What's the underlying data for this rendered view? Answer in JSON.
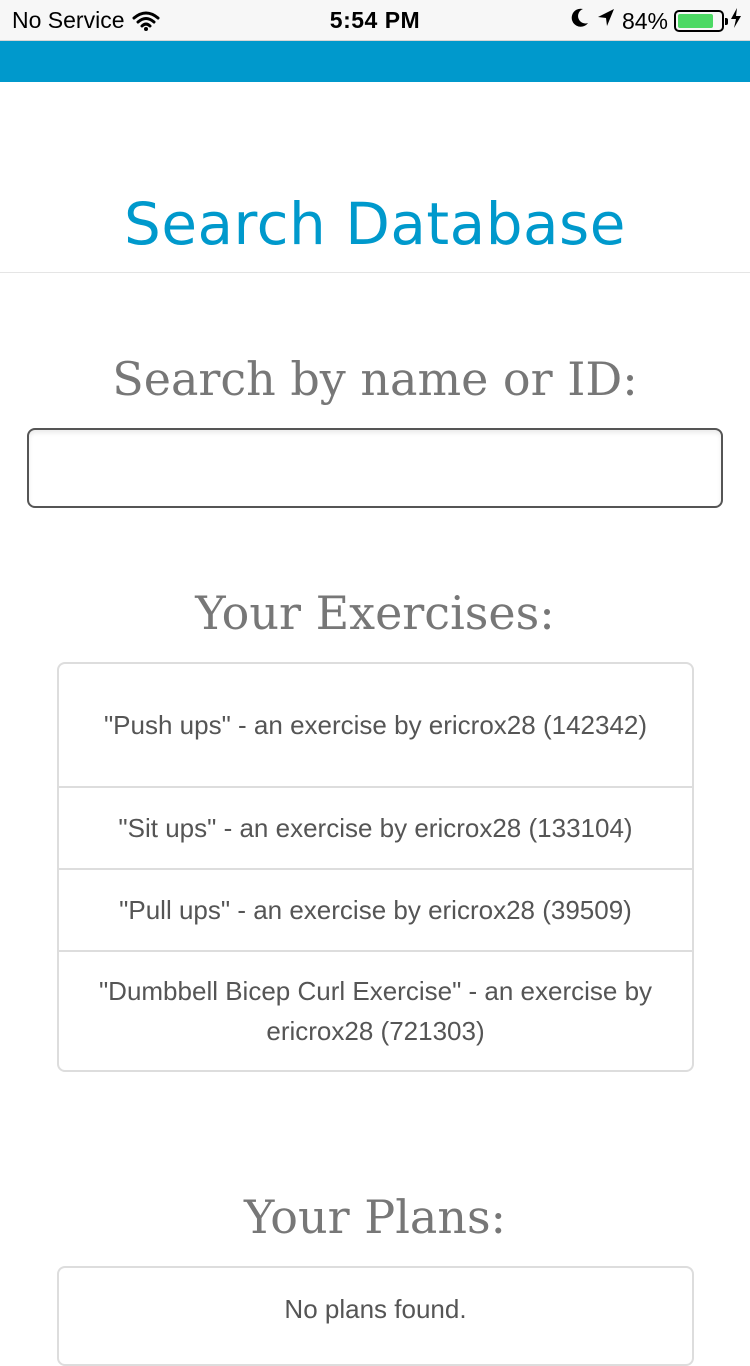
{
  "status_bar": {
    "carrier": "No Service",
    "time": "5:54 PM",
    "battery_percent": "84%",
    "battery_level": 0.84,
    "battery_color": "#4cd964",
    "icons": [
      "wifi-icon",
      "moon-icon",
      "location-icon",
      "battery-icon",
      "bolt-icon"
    ]
  },
  "nav": {
    "color": "#0099cc"
  },
  "header": {
    "title": "Search Database"
  },
  "search": {
    "label": "Search by name or ID:",
    "value": "",
    "placeholder": ""
  },
  "exercises": {
    "heading": "Your Exercises:",
    "items": [
      {
        "label": "\"Push ups\" - an exercise by ericrox28 (142342)"
      },
      {
        "label": "\"Sit ups\" - an exercise by ericrox28 (133104)"
      },
      {
        "label": "\"Pull ups\" - an exercise by ericrox28 (39509)"
      },
      {
        "label": "\"Dumbbell Bicep Curl Exercise\" - an exercise by ericrox28 (721303)"
      }
    ]
  },
  "plans": {
    "heading": "Your Plans:",
    "empty_text": "No plans found."
  },
  "colors": {
    "accent": "#0099cc",
    "heading_gray": "#777777",
    "text_gray": "#555555",
    "border": "#dddddd"
  }
}
